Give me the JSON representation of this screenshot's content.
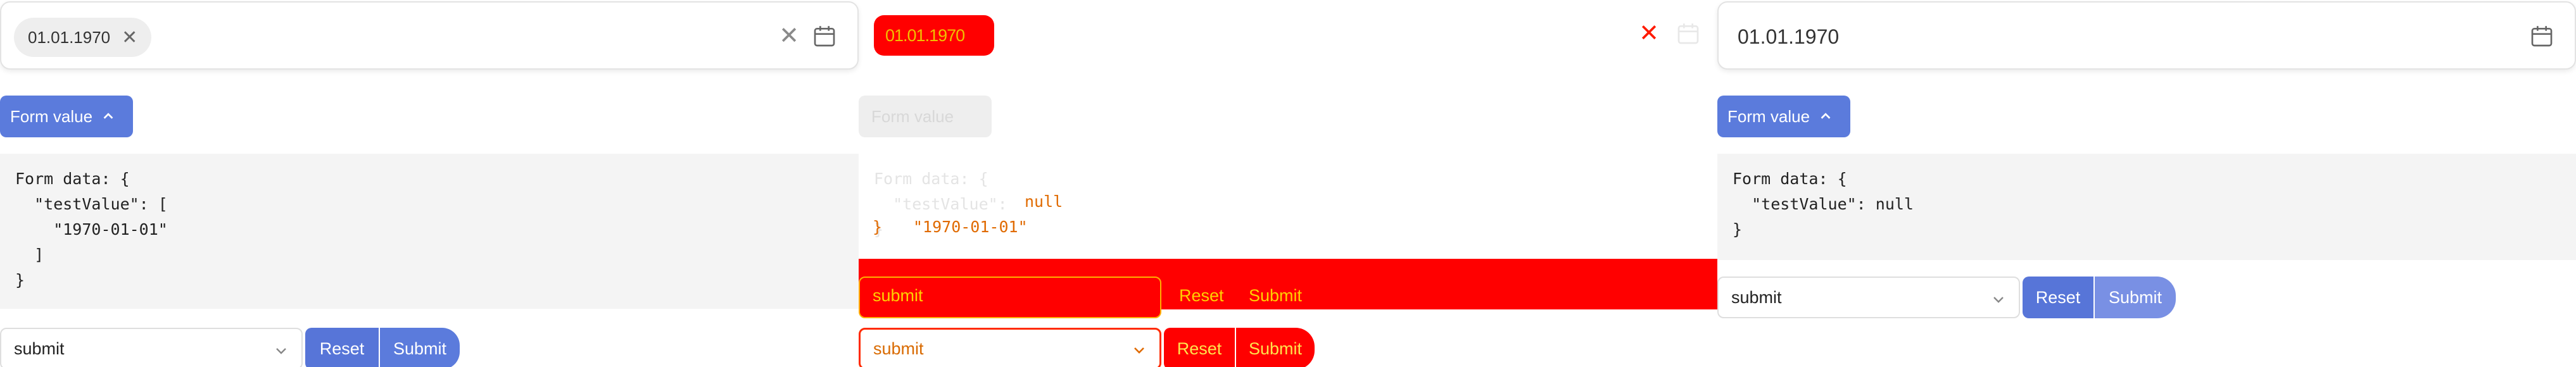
{
  "panel1": {
    "chip_value": "01.01.1970",
    "form_toggle_label": "Form value",
    "code": "Form data: {\n  \"testValue\": [\n    \"1970-01-01\"\n  ]\n}",
    "select_value": "submit",
    "reset_label": "Reset",
    "submit_label": "Submit"
  },
  "panel2": {
    "chip_value": "01.01.1970",
    "form_toggle_label": "Form value",
    "code_ghost": "Form data: {\n  \"testValue\": \n}",
    "diff_null": "null",
    "diff_date": "\"1970-01-01\"",
    "diff_brace": "}",
    "select_value": "submit",
    "reset_label": "Reset",
    "submit_label": "Submit"
  },
  "panel3": {
    "value": "01.01.1970",
    "form_toggle_label": "Form value",
    "code": "Form data: {\n  \"testValue\": null\n}",
    "select_value": "submit",
    "reset_label": "Reset",
    "submit_label": "Submit"
  },
  "colors": {
    "primary": "#5b7bdc",
    "error": "#ff0000",
    "warning": "#e06a00"
  },
  "icons": [
    "close-icon",
    "calendar-icon",
    "chevron-up-icon",
    "chevron-down-icon"
  ]
}
